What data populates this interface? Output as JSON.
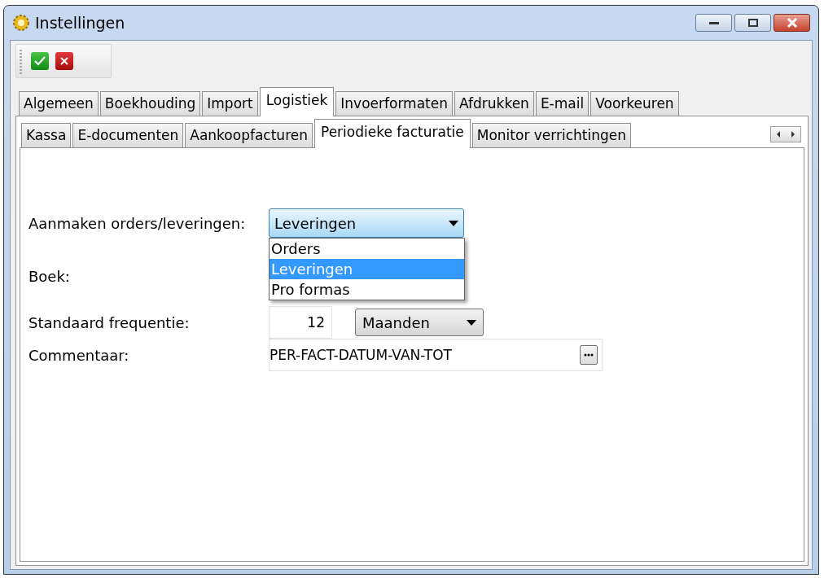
{
  "window": {
    "title": "Instellingen"
  },
  "toolbar": {
    "buttons": [
      {
        "kind": "ok"
      },
      {
        "kind": "cancel"
      }
    ]
  },
  "tabs": [
    {
      "label": "Algemeen",
      "selected": false
    },
    {
      "label": "Boekhouding",
      "selected": false
    },
    {
      "label": "Import",
      "selected": false
    },
    {
      "label": "Logistiek",
      "selected": true
    },
    {
      "label": "Invoerformaten",
      "selected": false
    },
    {
      "label": "Afdrukken",
      "selected": false
    },
    {
      "label": "E-mail",
      "selected": false
    },
    {
      "label": "Voorkeuren",
      "selected": false
    }
  ],
  "subtabs": [
    {
      "label": "Kassa",
      "selected": false
    },
    {
      "label": "E-documenten",
      "selected": false
    },
    {
      "label": "Aankoopfacturen",
      "selected": false
    },
    {
      "label": "Periodieke facturatie",
      "selected": true
    },
    {
      "label": "Monitor verrichtingen",
      "selected": false
    }
  ],
  "form": {
    "fields": [
      {
        "kind": "dropdown",
        "label": "Aanmaken orders/leveringen:",
        "value": "Leveringen",
        "expanded": true,
        "options": [
          {
            "label": "Orders",
            "selected": false
          },
          {
            "label": "Leveringen",
            "selected": true
          },
          {
            "label": "Pro formas",
            "selected": false
          }
        ]
      },
      {
        "kind": "empty",
        "label": "Boek:"
      },
      {
        "kind": "frequency",
        "label": "Standaard frequentie:",
        "value": "12",
        "unit": "Maanden"
      },
      {
        "kind": "text",
        "label": "Commentaar:",
        "value": "PER-FACT-DATUM-VAN-TOT"
      }
    ]
  }
}
